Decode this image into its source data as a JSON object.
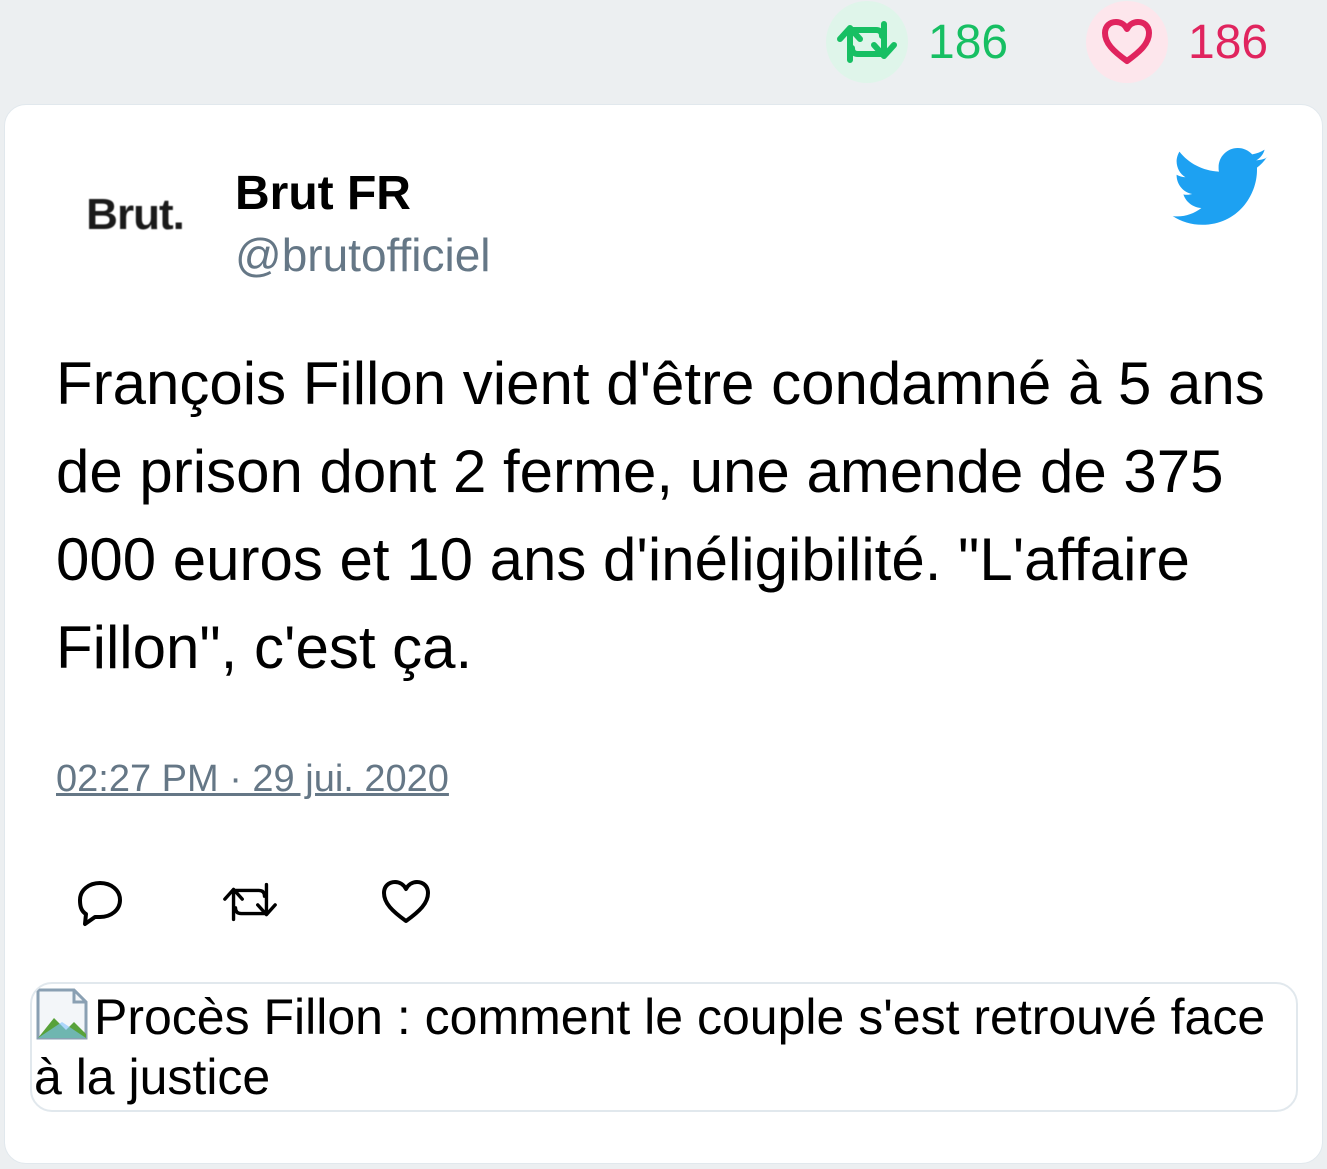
{
  "stats": {
    "retweet_count": "186",
    "like_count": "186",
    "retweet_color": "#17bf63",
    "like_color": "#e0245e"
  },
  "tweet": {
    "avatar_text": "Brut.",
    "user_name": "Brut FR",
    "handle": "@brutofficiel",
    "text": "François Fillon vient d'être condamné à 5 ans de prison dont 2 ferme, une amende de 375 000 euros et 10 ans d'inéligibilité. \"L'affaire Fillon\", c'est ça.",
    "timestamp": "02:27 PM · 29 jui. 2020",
    "brand_icon": "twitter-bird-icon",
    "actions": [
      "reply-icon",
      "retweet-icon",
      "like-icon"
    ]
  },
  "link_card": {
    "image_alt": "Procès Fillon : comment le couple s'est retrouvé face à la justice"
  }
}
